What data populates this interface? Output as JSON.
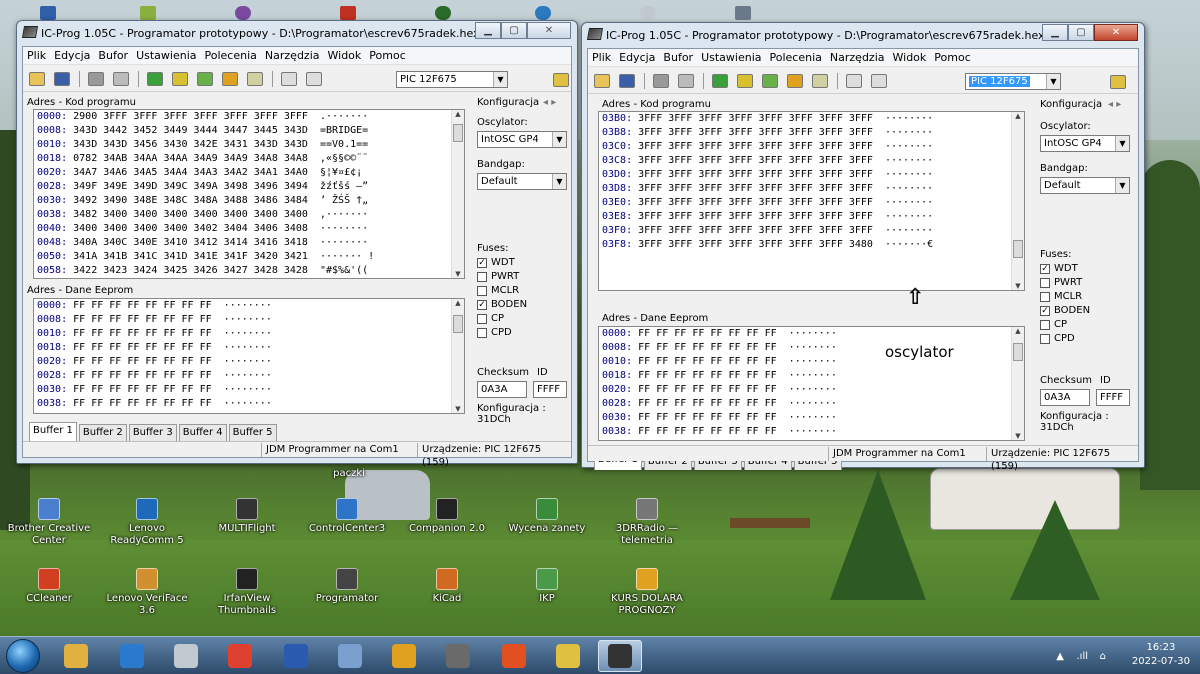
{
  "desktop": {
    "top_label": "paczki",
    "icons_row1": [
      {
        "label": "Brother Creative Center",
        "color": "#4a7fd0"
      },
      {
        "label": "Lenovo ReadyComm 5",
        "color": "#1f6ab8"
      },
      {
        "label": "MULTIFlight",
        "color": "#333333"
      },
      {
        "label": "ControlCenter3",
        "color": "#2e75c8"
      },
      {
        "label": "Companion 2.0",
        "color": "#222222"
      },
      {
        "label": "Wycena zanety",
        "color": "#3a8c3a"
      },
      {
        "label": "3DRRadio — telemetria",
        "color": "#777777"
      }
    ],
    "icons_row2": [
      {
        "label": "CCleaner",
        "color": "#d04020"
      },
      {
        "label": "Lenovo VeriFace 3.6",
        "color": "#d09030"
      },
      {
        "label": "IrfanView Thumbnails",
        "color": "#222222"
      },
      {
        "label": "Programator",
        "color": "#444444"
      },
      {
        "label": "KiCad",
        "color": "#d06a20"
      },
      {
        "label": "IKP",
        "color": "#4a9a4a"
      },
      {
        "label": "KURS DOLARA PROGNOZY",
        "color": "#e0a020"
      }
    ]
  },
  "window1": {
    "title": "IC-Prog 1.05C - Programator prototypowy - D:\\Programator\\escrev675radek.hex",
    "menu": [
      "Plik",
      "Edycja",
      "Bufor",
      "Ustawienia",
      "Polecenia",
      "Narzędzia",
      "Widok",
      "Pomoc"
    ],
    "device": "PIC 12F675",
    "code_title": "Adres - Kod programu",
    "code_rows": [
      {
        "addr": "0000:",
        "words": "2900 3FFF 3FFF 3FFF 3FFF 3FFF 3FFF 3FFF",
        "ascii": ".·······"
      },
      {
        "addr": "0008:",
        "words": "343D 3442 3452 3449 3444 3447 3445 343D",
        "ascii": "=BRIDGE="
      },
      {
        "addr": "0010:",
        "words": "343D 343D 3456 3430 342E 3431 343D 343D",
        "ascii": "==V0.1=="
      },
      {
        "addr": "0018:",
        "words": "0782 34AB 34AA 34AA 34A9 34A9 34A8 34A8",
        "ascii": ",«§§©©¨¨"
      },
      {
        "addr": "0020:",
        "words": "34A7 34A6 34A5 34A4 34A3 34A2 34A1 34A0",
        "ascii": "§¦¥¤£¢¡ "
      },
      {
        "addr": "0028:",
        "words": "349F 349E 349D 349C 349A 3498 3496 3494",
        "ascii": "žźťšś –”"
      },
      {
        "addr": "0030:",
        "words": "3492 3490 348E 348C 348A 3488 3486 3484",
        "ascii": "’ ŽŚŠ †„"
      },
      {
        "addr": "0038:",
        "words": "3482 3400 3400 3400 3400 3400 3400 3400",
        "ascii": "‚·······"
      },
      {
        "addr": "0040:",
        "words": "3400 3400 3400 3400 3402 3404 3406 3408",
        "ascii": "········"
      },
      {
        "addr": "0048:",
        "words": "340A 340C 340E 3410 3412 3414 3416 3418",
        "ascii": "········"
      },
      {
        "addr": "0050:",
        "words": "341A 341B 341C 341D 341E 341F 3420 3421",
        "ascii": "······· !"
      },
      {
        "addr": "0058:",
        "words": "3422 3423 3424 3425 3426 3427 3428 3428",
        "ascii": "\"#$%&'(("
      }
    ],
    "eeprom_title": "Adres - Dane Eeprom",
    "eeprom_rows": [
      {
        "addr": "0000:",
        "bytes": "FF FF FF FF FF FF FF FF",
        "ascii": "········"
      },
      {
        "addr": "0008:",
        "bytes": "FF FF FF FF FF FF FF FF",
        "ascii": "········"
      },
      {
        "addr": "0010:",
        "bytes": "FF FF FF FF FF FF FF FF",
        "ascii": "········"
      },
      {
        "addr": "0018:",
        "bytes": "FF FF FF FF FF FF FF FF",
        "ascii": "········"
      },
      {
        "addr": "0020:",
        "bytes": "FF FF FF FF FF FF FF FF",
        "ascii": "········"
      },
      {
        "addr": "0028:",
        "bytes": "FF FF FF FF FF FF FF FF",
        "ascii": "········"
      },
      {
        "addr": "0030:",
        "bytes": "FF FF FF FF FF FF FF FF",
        "ascii": "········"
      },
      {
        "addr": "0038:",
        "bytes": "FF FF FF FF FF FF FF FF",
        "ascii": "········"
      }
    ],
    "config_title": "Konfiguracja",
    "osc_label": "Oscylator:",
    "osc_value": "IntOSC GP4",
    "bandgap_label": "Bandgap:",
    "bandgap_value": "Default",
    "fuses_label": "Fuses:",
    "fuses": [
      {
        "label": "WDT",
        "checked": true
      },
      {
        "label": "PWRT",
        "checked": false
      },
      {
        "label": "MCLR",
        "checked": false
      },
      {
        "label": "BODEN",
        "checked": true
      },
      {
        "label": "CP",
        "checked": false
      },
      {
        "label": "CPD",
        "checked": false
      }
    ],
    "checksum_label": "Checksum",
    "checksum_value": "0A3A",
    "id_label": "ID",
    "id_value": "FFFF",
    "config_value": "Konfiguracja : 31DCh",
    "buffers": [
      "Buffer 1",
      "Buffer 2",
      "Buffer 3",
      "Buffer 4",
      "Buffer 5"
    ],
    "status_programmer": "JDM Programmer na Com1",
    "status_device": "Urządzenie: PIC 12F675  (159)"
  },
  "window2": {
    "title": "IC-Prog 1.05C - Programator prototypowy - D:\\Programator\\escrev675radek.hex",
    "menu": [
      "Plik",
      "Edycja",
      "Bufor",
      "Ustawienia",
      "Polecenia",
      "Narzędzia",
      "Widok",
      "Pomoc"
    ],
    "device": "PIC 12F675",
    "code_title": "Adres - Kod programu",
    "code_rows": [
      {
        "addr": "03B0:",
        "words": "3FFF 3FFF 3FFF 3FFF 3FFF 3FFF 3FFF 3FFF",
        "ascii": "········"
      },
      {
        "addr": "03B8:",
        "words": "3FFF 3FFF 3FFF 3FFF 3FFF 3FFF 3FFF 3FFF",
        "ascii": "········"
      },
      {
        "addr": "03C0:",
        "words": "3FFF 3FFF 3FFF 3FFF 3FFF 3FFF 3FFF 3FFF",
        "ascii": "········"
      },
      {
        "addr": "03C8:",
        "words": "3FFF 3FFF 3FFF 3FFF 3FFF 3FFF 3FFF 3FFF",
        "ascii": "········"
      },
      {
        "addr": "03D0:",
        "words": "3FFF 3FFF 3FFF 3FFF 3FFF 3FFF 3FFF 3FFF",
        "ascii": "········"
      },
      {
        "addr": "03D8:",
        "words": "3FFF 3FFF 3FFF 3FFF 3FFF 3FFF 3FFF 3FFF",
        "ascii": "········"
      },
      {
        "addr": "03E0:",
        "words": "3FFF 3FFF 3FFF 3FFF 3FFF 3FFF 3FFF 3FFF",
        "ascii": "········"
      },
      {
        "addr": "03E8:",
        "words": "3FFF 3FFF 3FFF 3FFF 3FFF 3FFF 3FFF 3FFF",
        "ascii": "········"
      },
      {
        "addr": "03F0:",
        "words": "3FFF 3FFF 3FFF 3FFF 3FFF 3FFF 3FFF 3FFF",
        "ascii": "········"
      },
      {
        "addr": "03F8:",
        "words": "3FFF 3FFF 3FFF 3FFF 3FFF 3FFF 3FFF 3480",
        "ascii": "·······€"
      }
    ],
    "eeprom_title": "Adres - Dane Eeprom",
    "eeprom_rows": [
      {
        "addr": "0000:",
        "bytes": "FF FF FF FF FF FF FF FF",
        "ascii": "········"
      },
      {
        "addr": "0008:",
        "bytes": "FF FF FF FF FF FF FF FF",
        "ascii": "········"
      },
      {
        "addr": "0010:",
        "bytes": "FF FF FF FF FF FF FF FF",
        "ascii": "········"
      },
      {
        "addr": "0018:",
        "bytes": "FF FF FF FF FF FF FF FF",
        "ascii": "········"
      },
      {
        "addr": "0020:",
        "bytes": "FF FF FF FF FF FF FF FF",
        "ascii": "········"
      },
      {
        "addr": "0028:",
        "bytes": "FF FF FF FF FF FF FF FF",
        "ascii": "········"
      },
      {
        "addr": "0030:",
        "bytes": "FF FF FF FF FF FF FF FF",
        "ascii": "········"
      },
      {
        "addr": "0038:",
        "bytes": "FF FF FF FF FF FF FF FF",
        "ascii": "········"
      }
    ],
    "annotation": "oscylator",
    "config_title": "Konfiguracja",
    "osc_label": "Oscylator:",
    "osc_value": "IntOSC GP4",
    "bandgap_label": "Bandgap:",
    "bandgap_value": "Default",
    "fuses_label": "Fuses:",
    "fuses": [
      {
        "label": "WDT",
        "checked": true
      },
      {
        "label": "PWRT",
        "checked": false
      },
      {
        "label": "MCLR",
        "checked": false
      },
      {
        "label": "BODEN",
        "checked": true
      },
      {
        "label": "CP",
        "checked": false
      },
      {
        "label": "CPD",
        "checked": false
      }
    ],
    "checksum_label": "Checksum",
    "checksum_value": "0A3A",
    "id_label": "ID",
    "id_value": "FFFF",
    "config_value": "Konfiguracja : 31DCh",
    "buffers": [
      "Buffer 1",
      "Buffer 2",
      "Buffer 3",
      "Buffer 4",
      "Buffer 5"
    ],
    "status_programmer": "JDM Programmer na Com1",
    "status_device": "Urządzenie: PIC 12F675  (159)"
  },
  "taskbar": {
    "pinned": [
      {
        "name": "explorer-icon",
        "color": "#e0b040"
      },
      {
        "name": "media-player-icon",
        "color": "#2a7bd0"
      },
      {
        "name": "calculator-icon",
        "color": "#c0c8d0"
      },
      {
        "name": "chrome-icon",
        "color": "#e04030"
      },
      {
        "name": "save-disk-icon",
        "color": "#2a5bb0"
      },
      {
        "name": "paint-icon",
        "color": "#7aa0d0"
      },
      {
        "name": "bars-app-icon",
        "color": "#e0a020"
      },
      {
        "name": "sdr-icon",
        "color": "#6a6a6a"
      },
      {
        "name": "sun-app-icon",
        "color": "#e05020"
      },
      {
        "name": "notes-app-icon",
        "color": "#e0c040"
      },
      {
        "name": "icprog-icon",
        "color": "#333333"
      }
    ],
    "time": "16:23",
    "date": "2022-07-30"
  }
}
